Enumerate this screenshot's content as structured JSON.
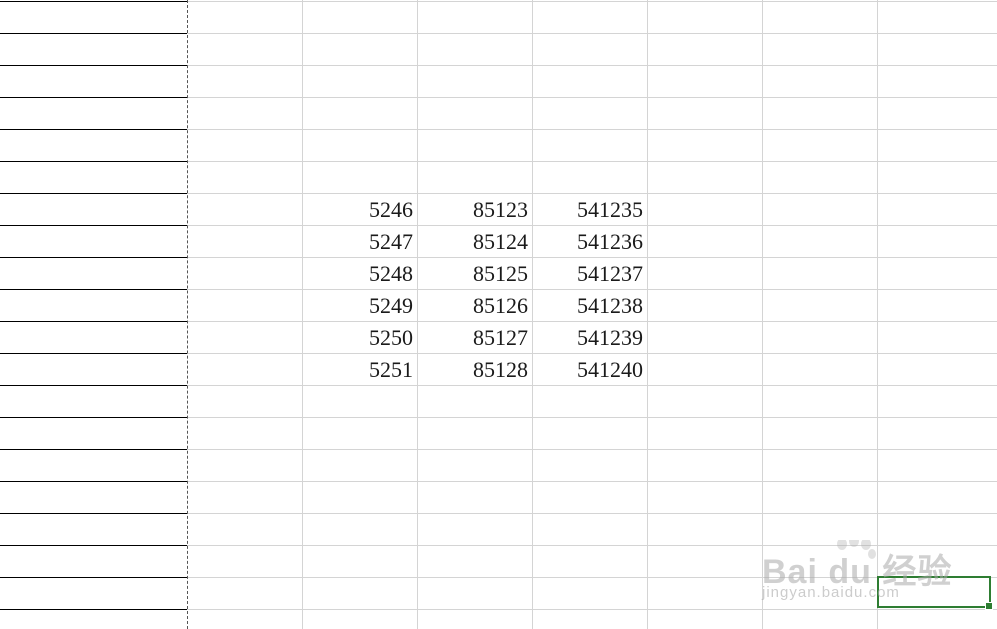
{
  "sheet": {
    "rows": [
      [
        "5246",
        "85123",
        "541235"
      ],
      [
        "5247",
        "85124",
        "541236"
      ],
      [
        "5248",
        "85125",
        "541237"
      ],
      [
        "5249",
        "85126",
        "541238"
      ],
      [
        "5250",
        "85127",
        "541239"
      ],
      [
        "5251",
        "85128",
        "541240"
      ]
    ]
  },
  "watermark": {
    "main": "Bai du 经验",
    "sub": "jingyan.baidu.com"
  },
  "colors": {
    "gridline": "#d4d4d4",
    "col_a_border": "#000000",
    "selection": "#2e7d32",
    "cell_text": "#1a1a1a"
  }
}
